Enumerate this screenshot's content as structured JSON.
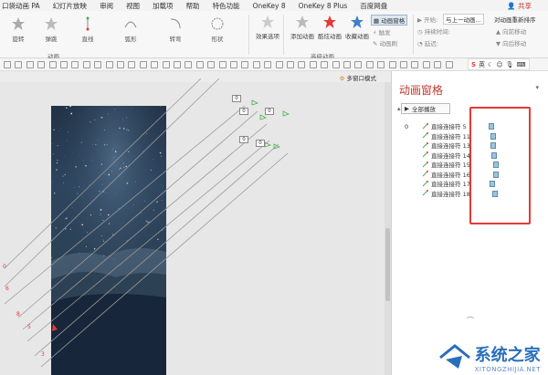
{
  "ribbon_tabs": [
    "口袋动画 PA",
    "幻灯片放映",
    "审阅",
    "视图",
    "加载项",
    "帮助",
    "特色功能",
    "OneKey 8",
    "OneKey 8 Plus",
    "百度网盘"
  ],
  "share_label": "共享",
  "gallery": [
    "旋转",
    "弹跳",
    "直线",
    "弧形",
    "转弯",
    "形状"
  ],
  "groups": {
    "animation": "动画",
    "advanced_animation": "高级动画"
  },
  "effect_options": "效果选项",
  "add_animation": "添加动画",
  "anim_painter": "酷炫动画",
  "collect_animation": "收藏动画",
  "anim_pane_btn": "动画窗格",
  "trigger": "触发",
  "anim_brush": "动画刷",
  "start_label": "开始:",
  "start_value": "与上一动画...",
  "duration_label": "持续时间:",
  "delay_label": "延迟:",
  "reorder_title": "对动画重新排序",
  "move_earlier": "向前移动",
  "move_later": "向后移动",
  "sogou": "英",
  "multi_window": "多窗口模式",
  "pane_title": "动画窗格",
  "play_all": "全部播放",
  "first_index": "0",
  "anim_items": [
    "直接连接符 5",
    "直接连接符 11",
    "直接连接符 13",
    "直接连接符 14",
    "直接连接符 15",
    "直接连接符 16",
    "直接连接符 17",
    "直接连接符 18"
  ],
  "anim_bar_offsets": [
    0.25,
    0.45,
    0.45,
    0.5,
    0.7,
    0.7,
    0.35,
    0.55
  ],
  "slide_tags": [
    "0",
    "0",
    "0",
    "0",
    "0"
  ],
  "left_markers": [
    "0",
    "6",
    "8",
    "5",
    "3"
  ],
  "watermark": {
    "name": "系统之家",
    "url": "XITONGZHIJIA.NET"
  },
  "colors": {
    "accent": "#c0392b",
    "highlight": "#e53935",
    "bar": "#9ec4dd",
    "green": "#4caf50"
  }
}
